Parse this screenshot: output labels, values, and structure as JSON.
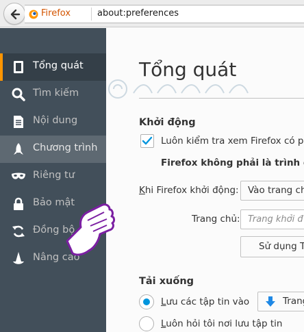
{
  "browser": {
    "identity_label": "Firefox",
    "url": "about:preferences"
  },
  "sidebar": {
    "items": [
      {
        "label": "Tổng quát",
        "icon": "general-icon",
        "state": "selected"
      },
      {
        "label": "Tìm kiếm",
        "icon": "search-icon",
        "state": "normal"
      },
      {
        "label": "Nội dung",
        "icon": "content-icon",
        "state": "normal"
      },
      {
        "label": "Chương trình",
        "icon": "applications-icon",
        "state": "hover"
      },
      {
        "label": "Riêng tư",
        "icon": "privacy-mask-icon",
        "state": "normal"
      },
      {
        "label": "Bảo mật",
        "icon": "security-lock-icon",
        "state": "normal"
      },
      {
        "label": "Đồng bộ",
        "icon": "sync-icon",
        "state": "normal"
      },
      {
        "label": "Nâng cao",
        "icon": "advanced-wizard-icon",
        "state": "normal"
      }
    ]
  },
  "main": {
    "title": "Tổng quát",
    "startup": {
      "heading": "Khởi động",
      "check_default_label": "Luôn kiểm tra xem Firefox có ph",
      "check_default_checked": true,
      "not_default_text": "Firefox không phải là trình duy",
      "when_starts_label": "hi Firefox khởi động:",
      "when_starts_key": "K",
      "when_starts_value": "Vào trang ch",
      "homepage_label": "Trang chủ:",
      "homepage_placeholder": "Trang khởi đ",
      "use_current_button": "Sử dụng T"
    },
    "downloads": {
      "heading": "Tải xuống",
      "save_to_key": "L",
      "save_to_label": "ưu các tập tin vào",
      "save_to_selected": true,
      "folder_value": "Trang",
      "always_ask_key": "L",
      "always_ask_label": "uôn hỏi tôi nơi lưu tập tin",
      "always_ask_selected": false
    }
  },
  "colors": {
    "sidebar_bg": "#424f5a",
    "accent_orange": "#ff9500",
    "accent_blue": "#0095dd"
  }
}
